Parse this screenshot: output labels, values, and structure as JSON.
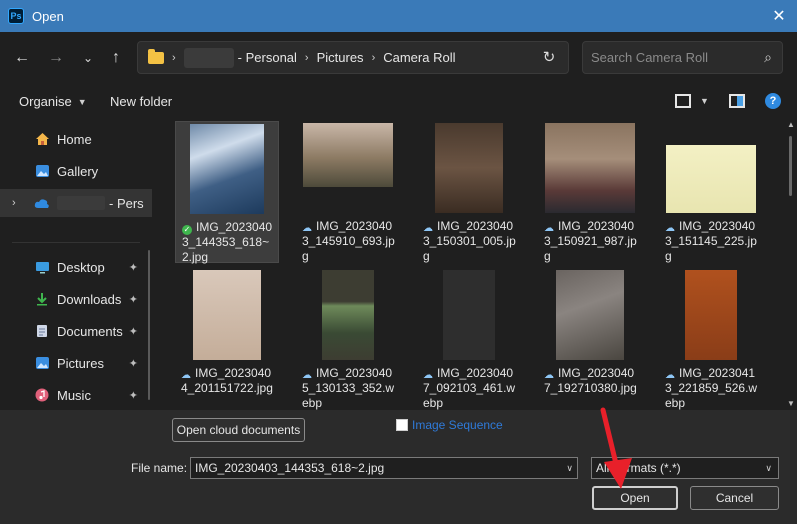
{
  "window": {
    "title": "Open",
    "app_icon": "ps-icon",
    "app_icon_text": "Ps",
    "close_glyph": "✕"
  },
  "nav": {
    "back": "←",
    "forward": "→",
    "recent": "⌄",
    "up": "↑",
    "crumb_sep": "›",
    "breadcrumb": [
      "- Personal",
      "Pictures",
      "Camera Roll"
    ],
    "refresh_glyph": "↻",
    "search_placeholder": "Search Camera Roll",
    "search_glyph": "⌕"
  },
  "toolbar": {
    "organise": "Organise",
    "new_folder": "New folder",
    "help": "?"
  },
  "sidebar": {
    "items": [
      {
        "label": "Home",
        "icon": "home-icon"
      },
      {
        "label": "Gallery",
        "icon": "gallery-icon"
      },
      {
        "label": "- Pers",
        "icon": "cloud-icon"
      },
      {
        "label": "Desktop",
        "icon": "desktop-icon"
      },
      {
        "label": "Downloads",
        "icon": "downloads-icon"
      },
      {
        "label": "Documents",
        "icon": "documents-icon"
      },
      {
        "label": "Pictures",
        "icon": "pictures-icon"
      },
      {
        "label": "Music",
        "icon": "music-icon"
      }
    ],
    "pin_glyph": "📌"
  },
  "files": [
    {
      "name": "IMG_20230403_144353_618~2.jpg",
      "status": "synced"
    },
    {
      "name": "IMG_20230403_145910_693.jpg",
      "status": "cloud"
    },
    {
      "name": "IMG_20230403_150301_005.jpg",
      "status": "cloud"
    },
    {
      "name": "IMG_20230403_150921_987.jpg",
      "status": "cloud"
    },
    {
      "name": "IMG_20230403_151145_225.jpg",
      "status": "cloud"
    },
    {
      "name": "IMG_20230404_201151722.jpg",
      "status": "cloud"
    },
    {
      "name": "IMG_20230405_130133_352.webp",
      "status": "cloud"
    },
    {
      "name": "IMG_20230407_092103_461.webp",
      "status": "cloud"
    },
    {
      "name": "IMG_20230407_192710380.jpg",
      "status": "cloud"
    },
    {
      "name": "IMG_20230413_221859_526.webp",
      "status": "cloud"
    }
  ],
  "bottom": {
    "open_cloud": "Open cloud documents",
    "image_sequence": "Image Sequence",
    "file_name_label": "File name:",
    "file_name_value": "IMG_20230403_144353_618~2.jpg",
    "file_type": "All Formats (*.*)",
    "open": "Open",
    "cancel": "Cancel"
  },
  "colors": {
    "titlebar": "#3a7ab8",
    "accent": "#2f7ad8",
    "annotation_arrow": "#e8202a"
  }
}
